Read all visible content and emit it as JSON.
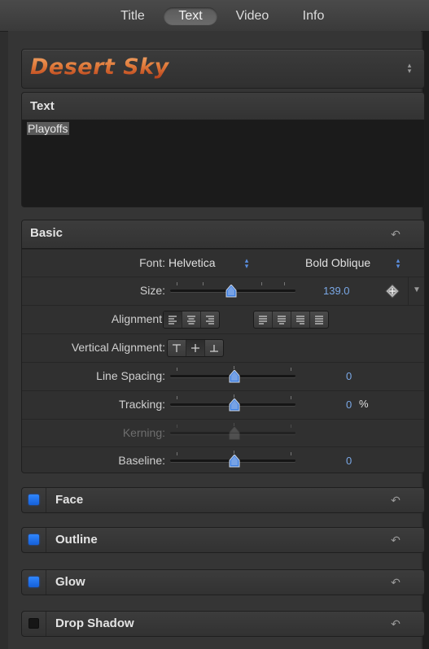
{
  "tabs": [
    {
      "label": "Title",
      "active": false
    },
    {
      "label": "Text",
      "active": true
    },
    {
      "label": "Video",
      "active": false
    },
    {
      "label": "Info",
      "active": false
    }
  ],
  "preset": {
    "name": "Desert Sky"
  },
  "text_editor": {
    "header": "Text",
    "value": "Playoffs"
  },
  "basic": {
    "header": "Basic",
    "font_label": "Font:",
    "font_family": "Helvetica",
    "font_style": "Bold Oblique",
    "size_label": "Size:",
    "size_value": "139.0",
    "alignment_label": "Alignment:",
    "vertical_alignment_label": "Vertical Alignment:",
    "line_spacing_label": "Line Spacing:",
    "line_spacing_value": "0",
    "tracking_label": "Tracking:",
    "tracking_value": "0",
    "tracking_unit": "%",
    "kerning_label": "Kerning:",
    "baseline_label": "Baseline:",
    "baseline_value": "0"
  },
  "sections": [
    {
      "label": "Face",
      "enabled": true
    },
    {
      "label": "Outline",
      "enabled": true
    },
    {
      "label": "Glow",
      "enabled": true
    },
    {
      "label": "Drop Shadow",
      "enabled": false
    }
  ],
  "colors": {
    "accent": "#2f86ff",
    "value_blue": "#7aa8e6",
    "preset_orange": "#e07a3a"
  }
}
